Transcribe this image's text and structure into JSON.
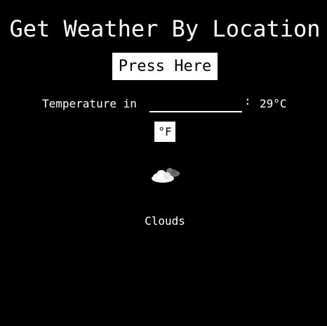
{
  "header": {
    "title": "Get Weather By Location"
  },
  "actions": {
    "press_label": "Press Here"
  },
  "temperature": {
    "label": "Temperature in",
    "location_value": "",
    "separator": ":",
    "value": "29°C",
    "unit_toggle_label": "°F"
  },
  "weather": {
    "icon": "partly-cloudy-icon",
    "condition": "Clouds"
  },
  "colors": {
    "background": "#000000",
    "text": "#ffffff",
    "button_bg": "#ffffff",
    "button_text": "#000000"
  }
}
